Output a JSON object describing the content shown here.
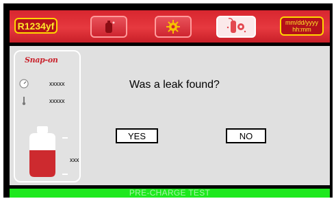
{
  "header": {
    "refrigerant": "R1234yf",
    "date_format": "mm/dd/yyyy",
    "time_format": "hh:mm",
    "buttons": [
      {
        "icon": "canister-icon"
      },
      {
        "icon": "gear-icon"
      },
      {
        "icon": "leak-test-icon",
        "active": true
      }
    ]
  },
  "side_panel": {
    "brand": "Snap-on",
    "pressure_value": "xxxxx",
    "temperature_value": "xxxxx",
    "canister_value": "xxx"
  },
  "dialog": {
    "question": "Was a leak found?",
    "yes_label": "YES",
    "no_label": "NO"
  },
  "status_bar": {
    "text": "PRE-CHARGE TEST"
  },
  "colors": {
    "header_red": "#e6393f",
    "accent_yellow": "#ffe82a",
    "status_green": "#1ee81e",
    "canister_red": "#cd2a2f"
  }
}
